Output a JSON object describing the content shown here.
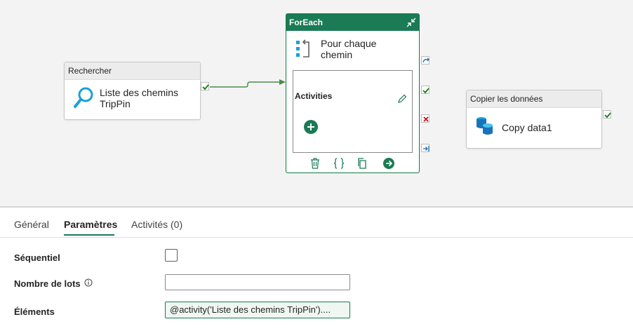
{
  "canvas": {
    "rechercher": {
      "header": "Rechercher",
      "label_line1": "Liste des chemins",
      "label_line2": "TripPin"
    },
    "foreach": {
      "header": "ForEach",
      "label_line1": "Pour chaque",
      "label_line2": "chemin",
      "inner_title": "Activities"
    },
    "copy": {
      "header": "Copier les données",
      "label": "Copy data1"
    }
  },
  "tabs": [
    {
      "label": "Général"
    },
    {
      "label": "Paramètres",
      "active": true
    },
    {
      "label": "Activités (0)"
    }
  ],
  "form": {
    "sequential_label": "Séquentiel",
    "batch_label": "Nombre de lots",
    "batch_value": "",
    "elements_label": "Éléments",
    "elements_value": "@activity('Liste des chemins TripPin')...."
  },
  "colors": {
    "accent": "#1a7b55",
    "success": "#107c10",
    "failure": "#c50f1f",
    "lookup": "#1aa0d8"
  }
}
